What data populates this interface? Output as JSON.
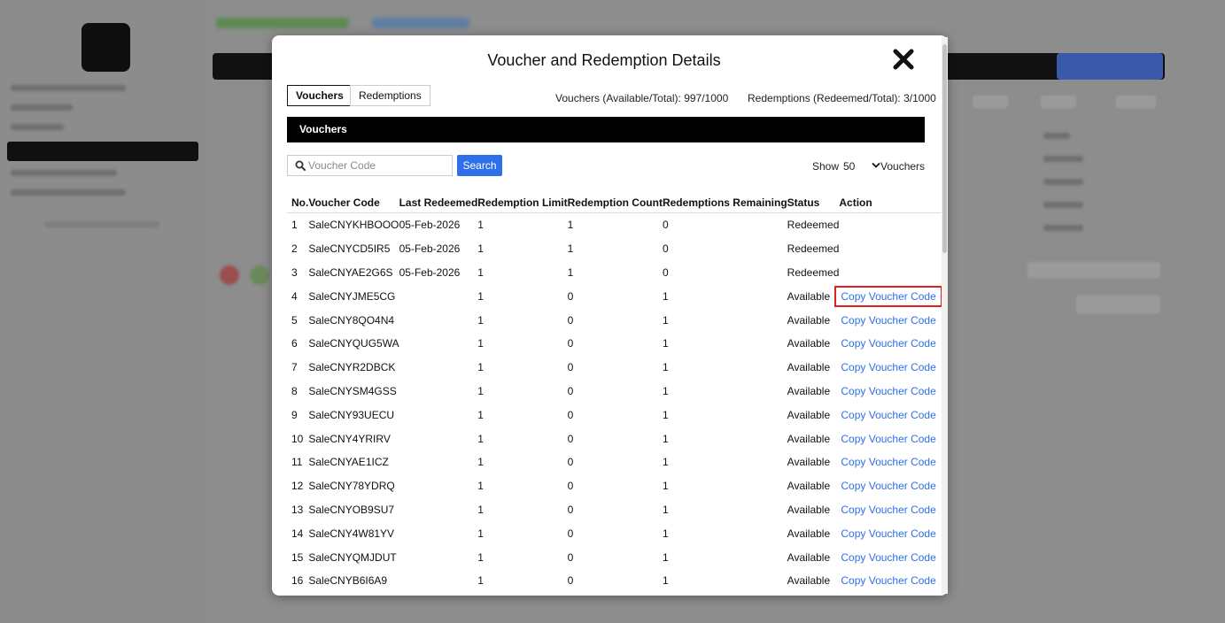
{
  "modal": {
    "title": "Voucher and Redemption Details",
    "tabs": [
      {
        "label": "Vouchers",
        "active": true
      },
      {
        "label": "Redemptions",
        "active": false
      }
    ],
    "vouchers_summary": "Vouchers (Available/Total): 997/1000",
    "redemptions_summary": "Redemptions (Redeemed/Total): 3/1000",
    "section_title": "Vouchers",
    "search": {
      "placeholder": "Voucher Code",
      "value": "",
      "button_label": "Search"
    },
    "page_size": {
      "prefix": "Show",
      "selected": "50",
      "suffix": "Vouchers"
    },
    "columns": [
      "No.",
      "Voucher Code",
      "Last Redeemed",
      "Redemption Limit",
      "Redemption Count",
      "Redemptions Remaining",
      "Status",
      "Action"
    ],
    "rows": [
      {
        "no": "1",
        "code": "SaleCNYKHBOOO",
        "last": "05-Feb-2026",
        "limit": "1",
        "count": "1",
        "remaining": "0",
        "status": "Redeemed",
        "action": ""
      },
      {
        "no": "2",
        "code": "SaleCNYCD5IR5",
        "last": "05-Feb-2026",
        "limit": "1",
        "count": "1",
        "remaining": "0",
        "status": "Redeemed",
        "action": ""
      },
      {
        "no": "3",
        "code": "SaleCNYAE2G6S",
        "last": "05-Feb-2026",
        "limit": "1",
        "count": "1",
        "remaining": "0",
        "status": "Redeemed",
        "action": ""
      },
      {
        "no": "4",
        "code": "SaleCNYJME5CG",
        "last": "",
        "limit": "1",
        "count": "0",
        "remaining": "1",
        "status": "Available",
        "action": "Copy Voucher Code",
        "highlight": true
      },
      {
        "no": "5",
        "code": "SaleCNY8QO4N4",
        "last": "",
        "limit": "1",
        "count": "0",
        "remaining": "1",
        "status": "Available",
        "action": "Copy Voucher Code"
      },
      {
        "no": "6",
        "code": "SaleCNYQUG5WA",
        "last": "",
        "limit": "1",
        "count": "0",
        "remaining": "1",
        "status": "Available",
        "action": "Copy Voucher Code"
      },
      {
        "no": "7",
        "code": "SaleCNYR2DBCK",
        "last": "",
        "limit": "1",
        "count": "0",
        "remaining": "1",
        "status": "Available",
        "action": "Copy Voucher Code"
      },
      {
        "no": "8",
        "code": "SaleCNYSM4GSS",
        "last": "",
        "limit": "1",
        "count": "0",
        "remaining": "1",
        "status": "Available",
        "action": "Copy Voucher Code"
      },
      {
        "no": "9",
        "code": "SaleCNY93UECU",
        "last": "",
        "limit": "1",
        "count": "0",
        "remaining": "1",
        "status": "Available",
        "action": "Copy Voucher Code"
      },
      {
        "no": "10",
        "code": "SaleCNY4YRIRV",
        "last": "",
        "limit": "1",
        "count": "0",
        "remaining": "1",
        "status": "Available",
        "action": "Copy Voucher Code"
      },
      {
        "no": "11",
        "code": "SaleCNYAE1ICZ",
        "last": "",
        "limit": "1",
        "count": "0",
        "remaining": "1",
        "status": "Available",
        "action": "Copy Voucher Code"
      },
      {
        "no": "12",
        "code": "SaleCNY78YDRQ",
        "last": "",
        "limit": "1",
        "count": "0",
        "remaining": "1",
        "status": "Available",
        "action": "Copy Voucher Code"
      },
      {
        "no": "13",
        "code": "SaleCNYOB9SU7",
        "last": "",
        "limit": "1",
        "count": "0",
        "remaining": "1",
        "status": "Available",
        "action": "Copy Voucher Code"
      },
      {
        "no": "14",
        "code": "SaleCNY4W81YV",
        "last": "",
        "limit": "1",
        "count": "0",
        "remaining": "1",
        "status": "Available",
        "action": "Copy Voucher Code"
      },
      {
        "no": "15",
        "code": "SaleCNYQMJDUT",
        "last": "",
        "limit": "1",
        "count": "0",
        "remaining": "1",
        "status": "Available",
        "action": "Copy Voucher Code"
      },
      {
        "no": "16",
        "code": "SaleCNYB6I6A9",
        "last": "",
        "limit": "1",
        "count": "0",
        "remaining": "1",
        "status": "Available",
        "action": "Copy Voucher Code"
      }
    ]
  },
  "icons": {
    "close": "close-icon",
    "search": "search-icon",
    "chevron": "chevron-down-icon"
  },
  "colors": {
    "accent_blue": "#2f6fe8",
    "highlight_red": "#e0201d",
    "section_bar": "#000000"
  }
}
